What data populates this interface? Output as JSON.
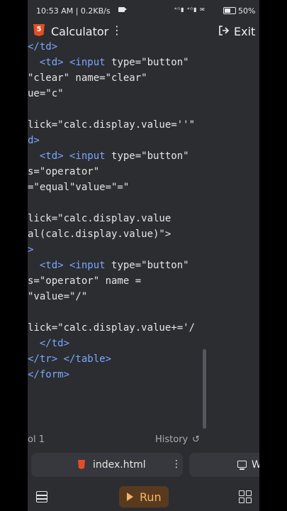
{
  "status_bar": {
    "time": "10:53 AM | 0.2KB/s",
    "icons_text": "⁴ᴳ▮ ⁴ᴳ▮ ✉",
    "battery": "50%"
  },
  "titlebar": {
    "title": "Calculator",
    "more": "⋮",
    "exit_label": "Exit"
  },
  "code_lines": [
    [
      {
        "t": "</td>",
        "c": "k"
      }
    ],
    [
      {
        "t": "  <td> <input ",
        "c": "k"
      },
      {
        "t": "type=\"button\"",
        "c": "s"
      }
    ],
    [
      {
        "t": "\"clear\" name=\"clear\"",
        "c": "s"
      }
    ],
    [
      {
        "t": "ue=\"c\"",
        "c": "s"
      }
    ],
    [
      {
        "t": "",
        "c": "s"
      }
    ],
    [
      {
        "t": "lick=\"calc.display.value=''\"",
        "c": "s"
      }
    ],
    [
      {
        "t": "d>",
        "c": "k"
      }
    ],
    [
      {
        "t": "  <td> <input ",
        "c": "k"
      },
      {
        "t": "type=\"button\"",
        "c": "s"
      }
    ],
    [
      {
        "t": "s=\"operator\"",
        "c": "s"
      }
    ],
    [
      {
        "t": "=\"equal\"value=\"=\"",
        "c": "s"
      }
    ],
    [
      {
        "t": "",
        "c": "s"
      }
    ],
    [
      {
        "t": "lick=\"calc.display.value",
        "c": "s"
      }
    ],
    [
      {
        "t": "al(calc.display.value)\">",
        "c": "s"
      }
    ],
    [
      {
        "t": ">",
        "c": "k"
      }
    ],
    [
      {
        "t": "  <td> <input ",
        "c": "k"
      },
      {
        "t": "type=\"button\"",
        "c": "s"
      }
    ],
    [
      {
        "t": "s=\"operator\" name =",
        "c": "s"
      }
    ],
    [
      {
        "t": "\"value=\"/\"",
        "c": "s"
      }
    ],
    [
      {
        "t": "",
        "c": "s"
      }
    ],
    [
      {
        "t": "lick=\"calc.display.value+='/",
        "c": "s"
      }
    ],
    [
      {
        "t": "  </td>",
        "c": "k"
      }
    ],
    [
      {
        "t": "</tr> </table>",
        "c": "k"
      }
    ],
    [
      {
        "t": "</form>",
        "c": "k"
      }
    ]
  ],
  "statusrow": {
    "col": "ol 1",
    "history": "History",
    "history_icon": "↺"
  },
  "tabs": {
    "index_label": "index.html",
    "index_more": "⋮",
    "web_label": "W"
  },
  "bottombar": {
    "run_label": "Run",
    "icons": [
      "list-icon",
      "play-icon",
      "grid-icon"
    ]
  },
  "colors": {
    "background": "#2b2d31",
    "tag": "#7da6ff",
    "run_bg": "#5a3a1e",
    "run_fg": "#f0b56a",
    "html_icon": "#e44d26"
  }
}
